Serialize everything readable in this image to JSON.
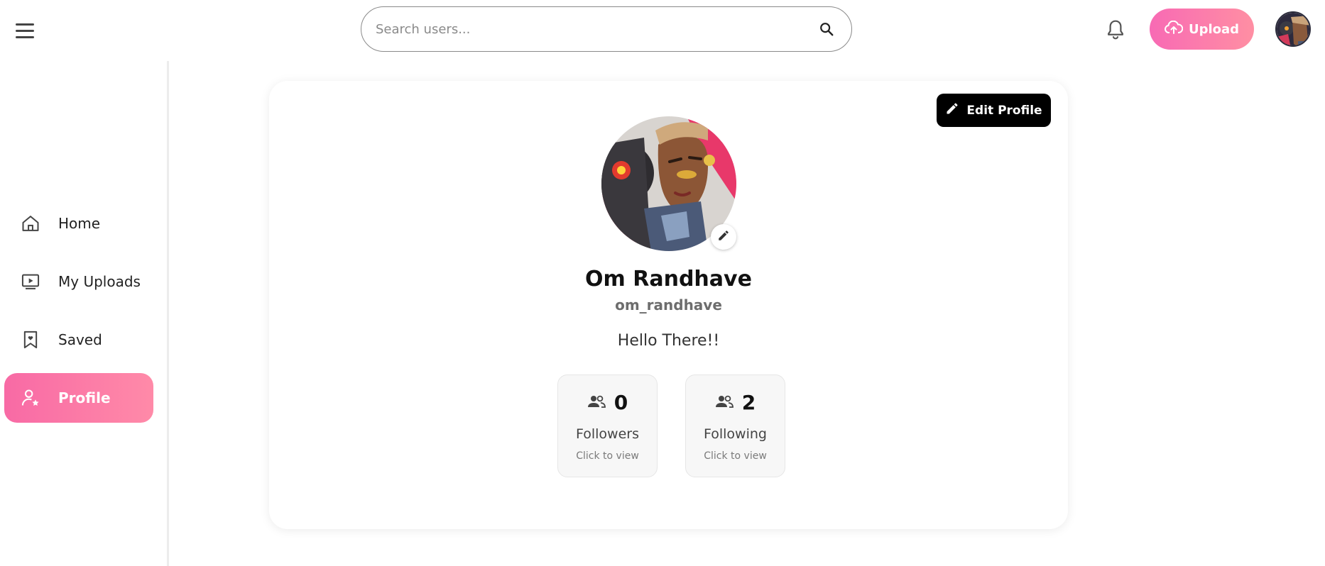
{
  "header": {
    "search_placeholder": "Search users...",
    "upload_label": "Upload"
  },
  "sidebar": {
    "items": [
      {
        "label": "Home",
        "icon": "home-icon"
      },
      {
        "label": "My Uploads",
        "icon": "video-icon"
      },
      {
        "label": "Saved",
        "icon": "bookmark-icon"
      },
      {
        "label": "Profile",
        "icon": "profile-icon",
        "active": true
      }
    ]
  },
  "profile": {
    "edit_label": "Edit Profile",
    "name": "Om Randhave",
    "username": "om_randhave",
    "bio": "Hello There!!",
    "followers": {
      "count": "0",
      "label": "Followers",
      "hint": "Click to view"
    },
    "following": {
      "count": "2",
      "label": "Following",
      "hint": "Click to view"
    }
  },
  "colors": {
    "accent_start": "#f86ab4",
    "accent_end": "#ff8fa3",
    "edit_button_bg": "#000000"
  }
}
